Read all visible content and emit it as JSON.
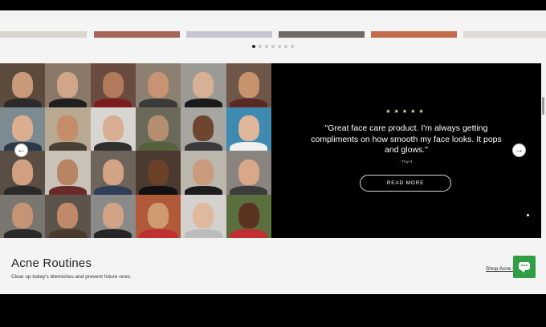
{
  "carousel": {
    "dot_count": 7,
    "active_index": 0
  },
  "strip": {
    "colors": [
      "#d9d6d0",
      "#a7655a",
      "#c7c4d3",
      "#6c6b66",
      "#c36a4d",
      "#dcdbd6"
    ]
  },
  "testimonial": {
    "stars": "★★★★★",
    "rating": 5,
    "star_color": "#e3e37a",
    "quote": "\"Great face care product. I'm always getting compliments on how smooth my face looks. It pops and glows.\"",
    "author": "- Troy H.",
    "read_more_label": "READ MORE",
    "prev_icon": "arrow-left-icon",
    "next_icon": "arrow-right-icon"
  },
  "collage": {
    "faces": [
      {
        "bg": "#5c4a3c",
        "skin": "#c99a7a",
        "shirt": "#2b2b2b"
      },
      {
        "bg": "#8a7868",
        "skin": "#d0a588",
        "shirt": "#1f1f1f"
      },
      {
        "bg": "#6a4b3f",
        "skin": "#b17a5a",
        "shirt": "#7c1c1c"
      },
      {
        "bg": "#8c8171",
        "skin": "#c89373",
        "shirt": "#3a3a3a"
      },
      {
        "bg": "#9c9a94",
        "skin": "#d8b096",
        "shirt": "#1a1a1a"
      },
      {
        "bg": "#6e5648",
        "skin": "#c7936f",
        "shirt": "#5a2a22"
      },
      {
        "bg": "#7c8a92",
        "skin": "#dcae8f",
        "shirt": "#2c3a48"
      },
      {
        "bg": "#b9a892",
        "skin": "#c48c68",
        "shirt": "#4a4036"
      },
      {
        "bg": "#d8d6d2",
        "skin": "#d9ae92",
        "shirt": "#303030"
      },
      {
        "bg": "#6b6a5a",
        "skin": "#b58e70",
        "shirt": "#55613a"
      },
      {
        "bg": "#a8a6a0",
        "skin": "#6e4630",
        "shirt": "#3a3a3a"
      },
      {
        "bg": "#3f8ab0",
        "skin": "#e0b69a",
        "shirt": "#f0f0f0"
      },
      {
        "bg": "#5a4e44",
        "skin": "#d0a080",
        "shirt": "#2a2a2a"
      },
      {
        "bg": "#c9c2b8",
        "skin": "#b88462",
        "shirt": "#6a2a2a"
      },
      {
        "bg": "#6f645a",
        "skin": "#d3a386",
        "shirt": "#2f3f5a"
      },
      {
        "bg": "#4a3a30",
        "skin": "#6b4128",
        "shirt": "#111111"
      },
      {
        "bg": "#bdb8ae",
        "skin": "#c99a7c",
        "shirt": "#1d1d1d"
      },
      {
        "bg": "#8a8480",
        "skin": "#d9a888",
        "shirt": "#3c3c3c"
      },
      {
        "bg": "#7a7670",
        "skin": "#c49474",
        "shirt": "#2a2a2a"
      },
      {
        "bg": "#5c544a",
        "skin": "#c08a6a",
        "shirt": "#4a3a2e"
      },
      {
        "bg": "#8a8a88",
        "skin": "#d0a386",
        "shirt": "#262626"
      },
      {
        "bg": "#b05a3a",
        "skin": "#d09a70",
        "shirt": "#c03030"
      },
      {
        "bg": "#d4d2ce",
        "skin": "#e0b89c",
        "shirt": "#bcbcbc"
      },
      {
        "bg": "#5a6e3e",
        "skin": "#5a3420",
        "shirt": "#c03030"
      },
      {
        "bg": "#3a3a3a",
        "skin": "#d7aa8c",
        "shirt": "#202020"
      },
      {
        "bg": "#7c6a5c",
        "skin": "#c8906c",
        "shirt": "#2a2a2a"
      },
      {
        "bg": "#6c665e",
        "skin": "#d3a588",
        "shirt": "#4a5a6a"
      },
      {
        "bg": "#b8a07e",
        "skin": "#cf9e7c",
        "shirt": "#3a3a3a"
      },
      {
        "bg": "#5e5650",
        "skin": "#c29272",
        "shirt": "#1c1c1c"
      },
      {
        "bg": "#2e2e2e",
        "skin": "#d5a586",
        "shirt": "#5a4030"
      }
    ]
  },
  "section": {
    "title": "Acne Routines",
    "subtitle": "Clear up today's blemishes and prevent future ones.",
    "shop_link": "Shop Acne R",
    "chat_icon": "chat-icon",
    "chat_color": "#2f9e44"
  }
}
